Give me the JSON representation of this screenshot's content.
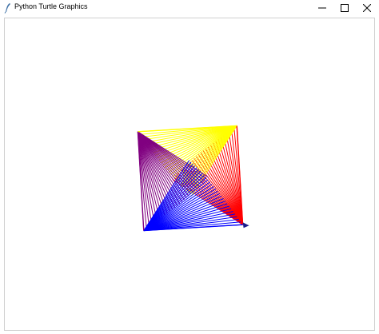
{
  "window": {
    "title": "Python Turtle Graphics",
    "app_icon": "feather-icon",
    "controls": {
      "minimize_icon": "minimize-icon",
      "maximize_icon": "maximize-icon",
      "close_icon": "close-icon"
    }
  },
  "canvas": {
    "background": "#ffffff",
    "drawing": "spiral-square-turtle-drawing",
    "line_colors": [
      "#ff0000",
      "#ffff00",
      "#800080",
      "#0000ff"
    ],
    "turtle_icon": "turtle-arrow-icon"
  }
}
